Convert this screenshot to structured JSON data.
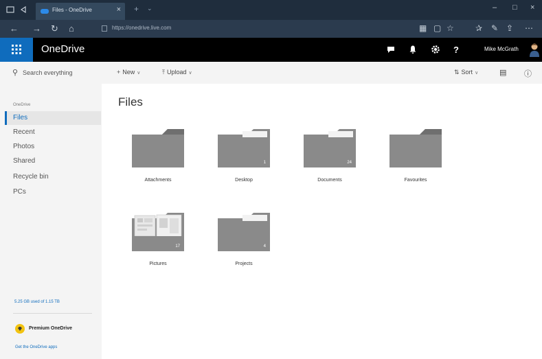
{
  "browser": {
    "tab_title": "Files - OneDrive",
    "tab_close": "×",
    "new_tab": "+",
    "tab_dropdown": "⌄",
    "window_min": "–",
    "window_max": "□",
    "window_close": "×",
    "url": "https://onedrive.live.com"
  },
  "suite": {
    "app_name": "OneDrive",
    "help_label": "?",
    "user_name": "Mike McGrath"
  },
  "commands": {
    "search_placeholder": "Search everything",
    "new_label": "New",
    "upload_label": "Upload",
    "sort_label": "Sort"
  },
  "nav": {
    "header": "OneDrive",
    "items": [
      {
        "label": "Files",
        "active": true
      },
      {
        "label": "Recent"
      },
      {
        "label": "Photos"
      },
      {
        "label": "Shared"
      },
      {
        "label": "Recycle bin"
      },
      {
        "label": "PCs"
      }
    ],
    "storage": "5.25 GB used of 1.15 TB",
    "premium": "Premium OneDrive",
    "apps_link": "Get the OneDrive apps"
  },
  "main": {
    "title": "Files",
    "folders": [
      {
        "name": "Attachments",
        "count": ""
      },
      {
        "name": "Desktop",
        "count": "1"
      },
      {
        "name": "Documents",
        "count": "24"
      },
      {
        "name": "Favourites",
        "count": ""
      },
      {
        "name": "Pictures",
        "count": "17",
        "preview": true
      },
      {
        "name": "Projects",
        "count": "4"
      }
    ]
  },
  "colors": {
    "accent": "#0f6cbd",
    "suite_bar": "#000000",
    "folder": "#8a8a8a",
    "folder_tab": "#6f6f6f",
    "premium": "#f2c311"
  },
  "icons": {
    "waffle": "app-launcher-icon",
    "chat": "chat-icon",
    "bell": "notifications-icon",
    "gear": "settings-icon",
    "help": "help-icon",
    "search": "search-icon",
    "new": "plus-icon",
    "upload": "upload-icon",
    "sort": "sort-icon",
    "view": "view-toggle-icon",
    "info": "info-icon"
  }
}
